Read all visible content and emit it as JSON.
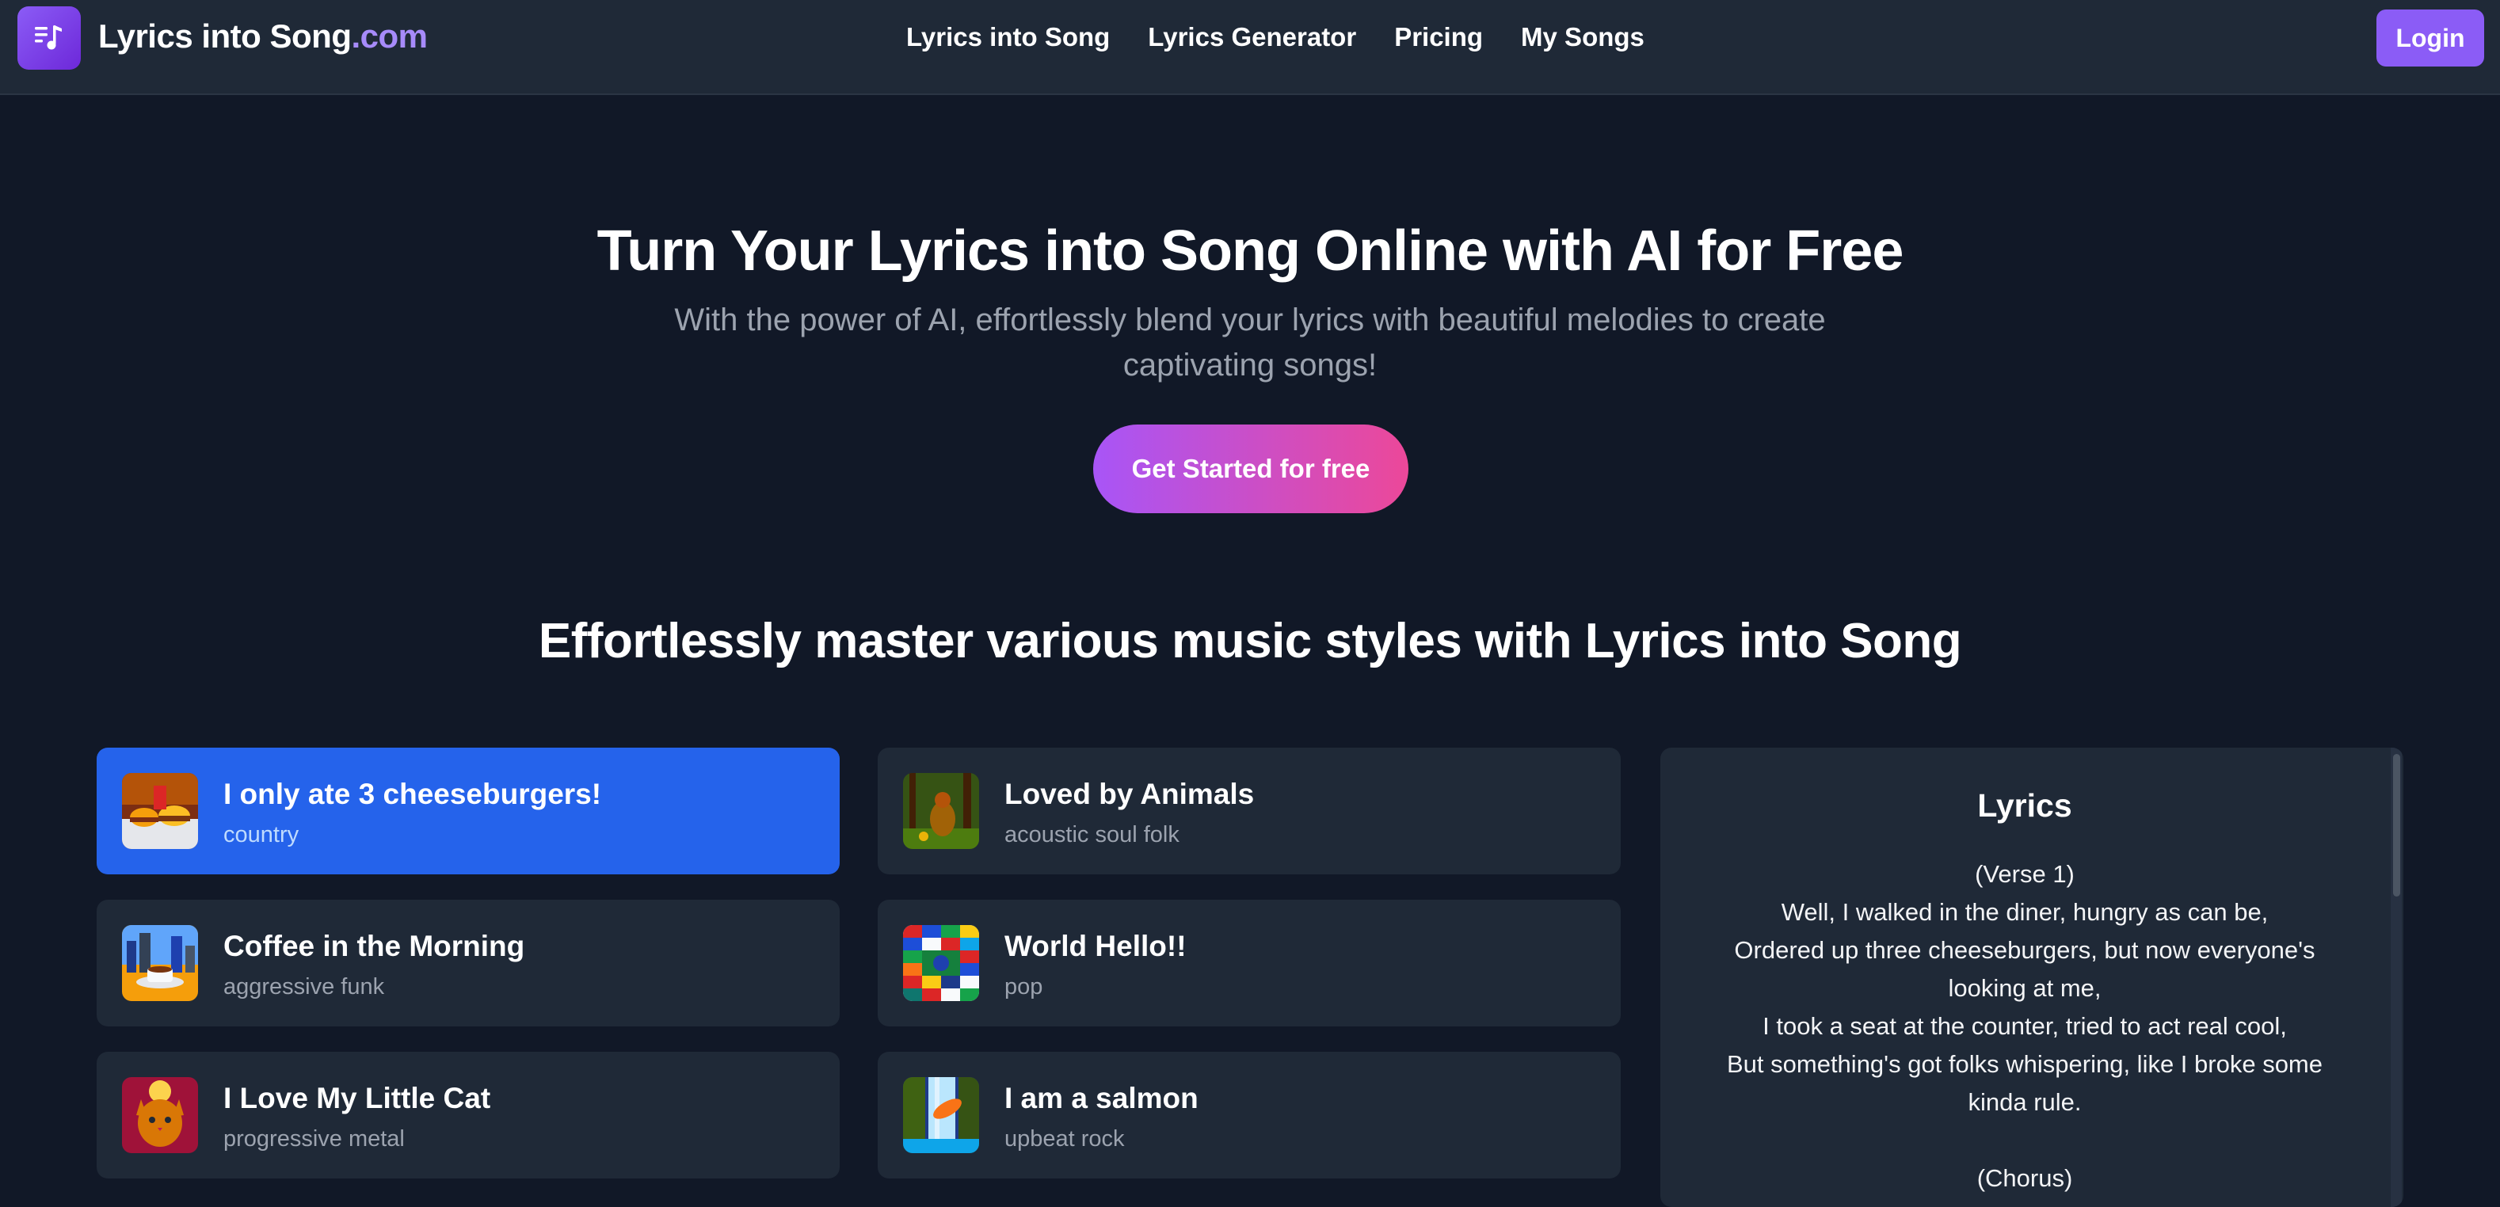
{
  "brand": {
    "name": "Lyrics into Song",
    "tld": ".com",
    "logo_icon": "music-note-list-icon"
  },
  "nav": [
    {
      "label": "Lyrics into Song"
    },
    {
      "label": "Lyrics Generator"
    },
    {
      "label": "Pricing"
    },
    {
      "label": "My Songs"
    }
  ],
  "login_label": "Login",
  "hero": {
    "title": "Turn Your Lyrics into Song Online with AI for Free",
    "subtitle": "With the power of AI, effortlessly blend your lyrics with beautiful melodies to create captivating songs!",
    "cta": "Get Started for free"
  },
  "section_title": "Effortlessly master various music styles with Lyrics into Song",
  "songs": [
    {
      "title": "I only ate 3 cheeseburgers!",
      "style": "country",
      "active": true,
      "thumb": "diner-burgers"
    },
    {
      "title": "Loved by Animals",
      "style": "acoustic soul folk",
      "active": false,
      "thumb": "forest-animals"
    },
    {
      "title": "Coffee in the Morning",
      "style": "aggressive funk",
      "active": false,
      "thumb": "coffee-city"
    },
    {
      "title": "World Hello!!",
      "style": "pop",
      "active": false,
      "thumb": "world-flags"
    },
    {
      "title": "I Love My Little Cat",
      "style": "progressive metal",
      "active": false,
      "thumb": "cat-portrait"
    },
    {
      "title": "I am a salmon",
      "style": "upbeat rock",
      "active": false,
      "thumb": "salmon-waterfall"
    }
  ],
  "lyrics": {
    "heading": "Lyrics",
    "text": "(Verse 1)\nWell, I walked in the diner, hungry as can be,\nOrdered up three cheeseburgers, but now everyone's looking at me,\nI took a seat at the counter, tried to act real cool,\nBut something's got folks whispering, like I broke some kinda rule.\n\n(Chorus)"
  },
  "colors": {
    "background": "#111827",
    "header": "#1f2937",
    "accent": "#8b5cf6",
    "active_card": "#2563eb",
    "cta_gradient": [
      "#a855f7",
      "#ec4899"
    ]
  }
}
